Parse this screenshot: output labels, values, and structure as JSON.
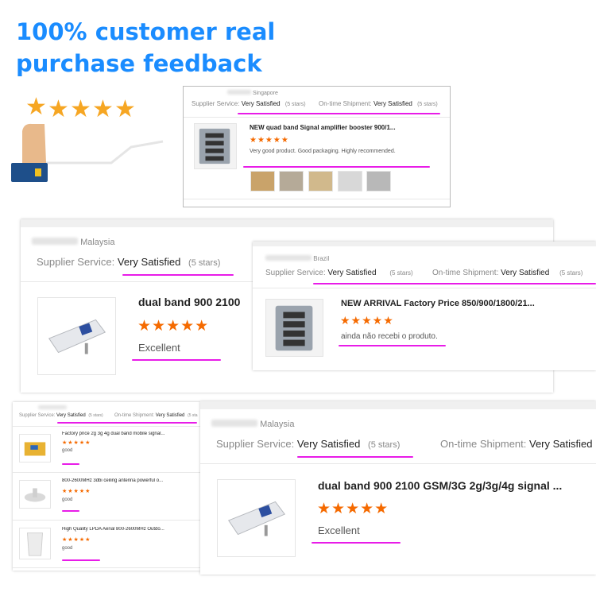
{
  "headline": "100% customer real purchase feedback",
  "colors": {
    "headline": "#1a8cff",
    "stars": "#f56a00",
    "underline": "#e81ce8"
  },
  "icons": [
    "hand-pointing-icon",
    "star-icon"
  ],
  "review_singapore": {
    "country": "Singapore",
    "supplier_label": "Supplier Service:",
    "supplier_value": "Very Satisfied",
    "supplier_stars": "(5 stars)",
    "ontime_label": "On-time Shipment:",
    "ontime_value": "Very Satisfied",
    "ontime_stars": "(5 stars)",
    "product_title": "NEW quad band Signal amplifier booster 900/1...",
    "stars": "★★★★★",
    "comment": "Very good product. Good packaging. Highly recommended."
  },
  "review_malaysia_1": {
    "country": "Malaysia",
    "supplier_label": "Supplier Service:",
    "supplier_value": "Very Satisfied",
    "supplier_stars": "(5 stars)",
    "product_title": "dual band 900 2100",
    "stars": "★★★★★",
    "comment": "Excellent"
  },
  "review_brazil": {
    "country": "Brazil",
    "supplier_label": "Supplier Service:",
    "supplier_value": "Very Satisfied",
    "supplier_stars": "(5 stars)",
    "ontime_label": "On-time Shipment:",
    "ontime_value": "Very Satisfied",
    "ontime_stars": "(5 stars)",
    "product_title": "NEW ARRIVAL Factory Price 850/900/1800/21...",
    "stars": "★★★★★",
    "comment": "ainda não recebi o produto."
  },
  "review_multi": {
    "supplier_label": "Supplier Service:",
    "supplier_value": "Very Satisfied",
    "supplier_stars": "(5 stars)",
    "ontime_label": "On-time Shipment:",
    "ontime_value": "Very Satisfied",
    "ontime_stars": "(5 sta",
    "items": [
      {
        "title": "Factory price 2g 3g 4g dual band mobile signal...",
        "stars": "★★★★★",
        "comment": "good"
      },
      {
        "title": "800-2600MHz 3dbi ceiling antenna powerful o...",
        "stars": "★★★★★",
        "comment": "good"
      },
      {
        "title": "High Quality LPDA Aerial 800-2600MHz Outdo...",
        "stars": "★★★★★",
        "comment": "good"
      }
    ]
  },
  "review_malaysia_2": {
    "country": "Malaysia",
    "supplier_label": "Supplier Service:",
    "supplier_value": "Very Satisfied",
    "supplier_stars": "(5 stars)",
    "ontime_label": "On-time Shipment:",
    "ontime_value": "Very Satisfied",
    "product_title": "dual band 900 2100 GSM/3G 2g/3g/4g signal ...",
    "stars": "★★★★★",
    "comment": "Excellent"
  }
}
